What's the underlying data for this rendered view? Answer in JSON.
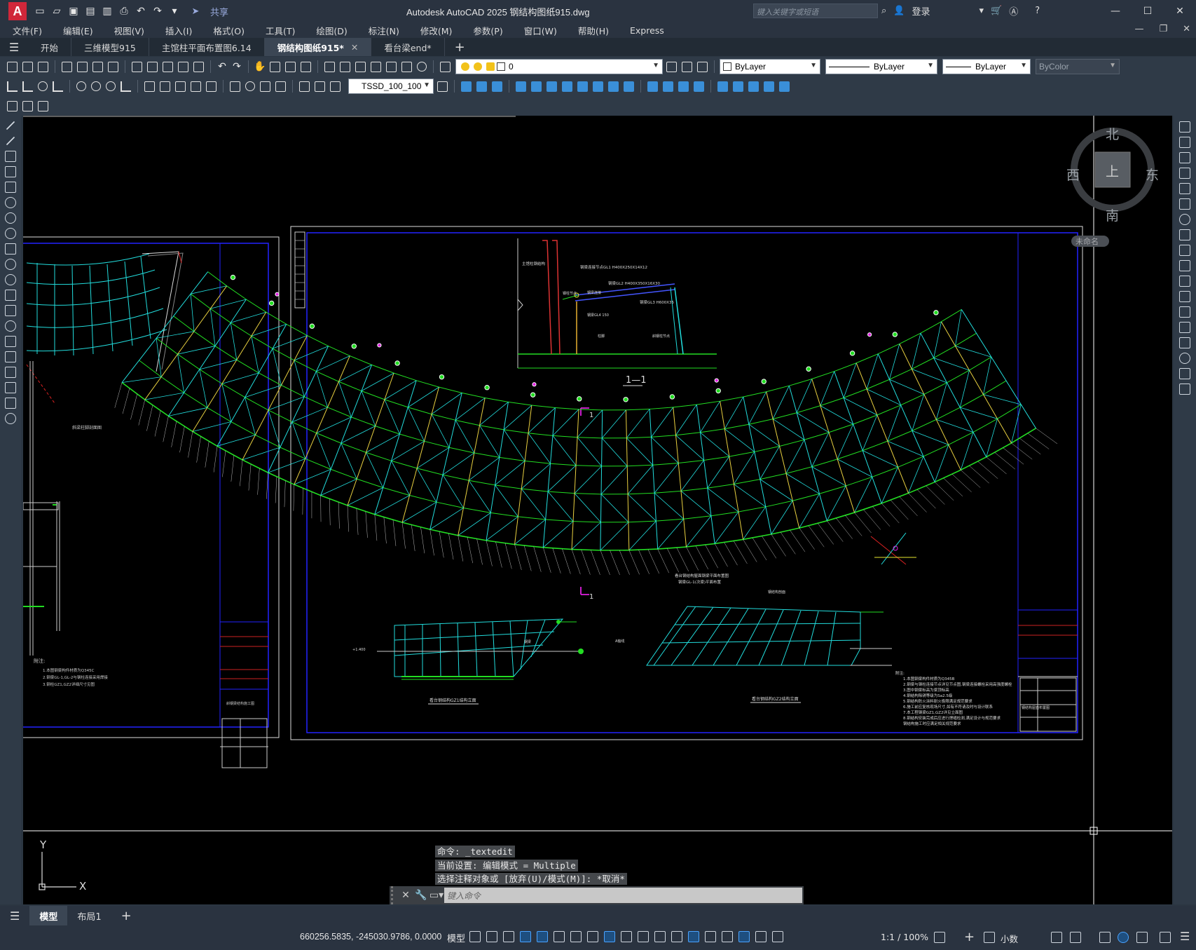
{
  "app": {
    "title": "Autodesk AutoCAD 2025    钢结构图纸915.dwg",
    "search_placeholder": "键入关键字或短语",
    "login_label": "登录",
    "share_label": "共享",
    "logo_letter": "A"
  },
  "menu": [
    "文件(F)",
    "编辑(E)",
    "视图(V)",
    "插入(I)",
    "格式(O)",
    "工具(T)",
    "绘图(D)",
    "标注(N)",
    "修改(M)",
    "参数(P)",
    "窗口(W)",
    "帮助(H)",
    "Express"
  ],
  "tabs": [
    {
      "label": "开始",
      "active": false
    },
    {
      "label": "三维模型915",
      "active": false
    },
    {
      "label": "主馆柱平面布置图6.14",
      "active": false
    },
    {
      "label": "钢结构图纸915*",
      "active": true
    },
    {
      "label": "看台梁end*",
      "active": false
    }
  ],
  "toolbar": {
    "layer_value": "0",
    "color_value": "ByLayer",
    "linetype_value": "ByLayer",
    "lineweight_value": "ByLayer",
    "plotstyle_value": "ByColor",
    "dimstyle_value": "TSSD_100_100"
  },
  "viewcube": {
    "north": "北",
    "south": "南",
    "east": "东",
    "west": "西",
    "face": "上",
    "wcs_label": "未命名"
  },
  "ucs": {
    "x": "X",
    "y": "Y"
  },
  "drawing": {
    "section_label": "1—1",
    "cut_mark_top": "1",
    "cut_mark_bottom": "1"
  },
  "command": {
    "history": [
      "命令: _textedit",
      "当前设置: 编辑模式 = Multiple",
      "选择注释对象或 [放弃(U)/模式(M)]: *取消*"
    ],
    "input_placeholder": "键入命令"
  },
  "layout_tabs": [
    {
      "label": "模型",
      "active": true
    },
    {
      "label": "布局1",
      "active": false
    }
  ],
  "status": {
    "coordinates": "660256.5835, -245030.9786, 0.0000",
    "space": "模型",
    "annotation_scale": "1:1 / 100%",
    "units": "小数"
  },
  "colors": {
    "canvas": "#000000",
    "frame_blue": "#1a1aff",
    "truss_green": "#22dd22",
    "truss_cyan": "#22dddd",
    "truss_yellow": "#e8d040",
    "marker_magenta": "#e020e0",
    "accent_red": "#d0273a"
  }
}
